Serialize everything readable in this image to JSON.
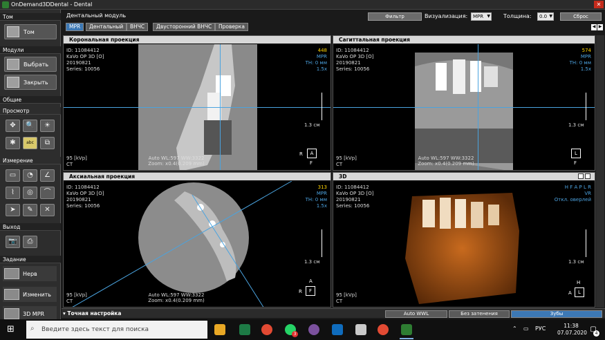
{
  "window": {
    "title": "OnDemand3DDental - Dental"
  },
  "left_panel": {
    "sections": {
      "tom": "Том",
      "modules": "Модули",
      "general": "Общие",
      "view": "Просмотр",
      "measure": "Измерение",
      "exit": "Выход",
      "task": "Задание"
    },
    "buttons": {
      "tom": "Том",
      "select": "Выбрать",
      "close": "Закрыть"
    },
    "tasks": [
      "Нерв",
      "Изменить",
      "3D MPR"
    ]
  },
  "header": {
    "title": "Дентальный модуль",
    "filter_button": "Фильтр",
    "visualization_label": "Визуализация:",
    "visualization_value": "MPR",
    "thickness_label": "Толщина:",
    "thickness_value": "0.0",
    "reset_button": "Сброс"
  },
  "tabs": [
    "MPR",
    "Дентальный",
    "ВНЧС",
    "Двусторонний ВНЧС",
    "Проверка"
  ],
  "views": {
    "coronal": {
      "title": "Корональная проекция",
      "info": "ID: 11084412\nKaVo OP 3D [O]\n20190821\nSeries: 10056",
      "slice": "448",
      "mode": "MPR",
      "th": "TH: 0 мм",
      "zoom": "1.5x",
      "scale": "1.3 см",
      "kvp": "95 [kVp]",
      "ct": "CT",
      "auto_wl": "Auto WL:597 WW:3322",
      "zoom_info": "Zoom: x0.4(0.209 mm)",
      "orient": {
        "left": "R",
        "box": "A",
        "bottom": "F"
      }
    },
    "sagittal": {
      "title": "Сагиттальная проекция",
      "info": "ID: 11084412\nKaVo OP 3D [O]\n20190821\nSeries: 10056",
      "slice": "574",
      "mode": "MPR",
      "th": "TH: 0 мм",
      "zoom": "1.5x",
      "scale": "1.3 см",
      "kvp": "95 [kVp]",
      "ct": "CT",
      "auto_wl": "Auto WL:597 WW:3322",
      "zoom_info": "Zoom: x0.4(0.209 mm)",
      "orient": {
        "box": "L",
        "bottom": "F"
      }
    },
    "axial": {
      "title": "Аксиальная проекция",
      "info": "ID: 11084412\nKaVo OP 3D [O]\n20190821\nSeries: 10056",
      "slice": "313",
      "mode": "MPR",
      "th": "TH: 0 мм",
      "zoom": "1.5x",
      "scale": "1.3 см",
      "kvp": "95 [kVp]",
      "ct": "CT",
      "auto_wl": "Auto WL:597 WW:3322",
      "zoom_info": "Zoom: x0.4(0.209 mm)",
      "orient": {
        "top": "A",
        "left": "R",
        "box": "F"
      }
    },
    "3d": {
      "title": "3D",
      "info": "ID: 11084412\nKaVo OP 3D [O]\n20190821\nSeries: 10056",
      "dirs": "H F A P L R",
      "mode": "VR",
      "overlay": "Откл. оверлей",
      "scale": "1.3 см",
      "kvp": "95 [kVp]",
      "ct": "CT",
      "orient": {
        "top": "H",
        "left": "A",
        "box": "L"
      }
    }
  },
  "bottom": {
    "fine_tune": "Точная настройка",
    "auto_wwl": "Auto WWL",
    "no_shading": "Без затенения",
    "teeth": "Зубы"
  },
  "taskbar": {
    "search_placeholder": "Введите здесь текст для поиска",
    "lang": "РУС",
    "time": "11:38",
    "date": "07.07.2020",
    "notification_count": "4",
    "whatsapp_badge": "3"
  }
}
